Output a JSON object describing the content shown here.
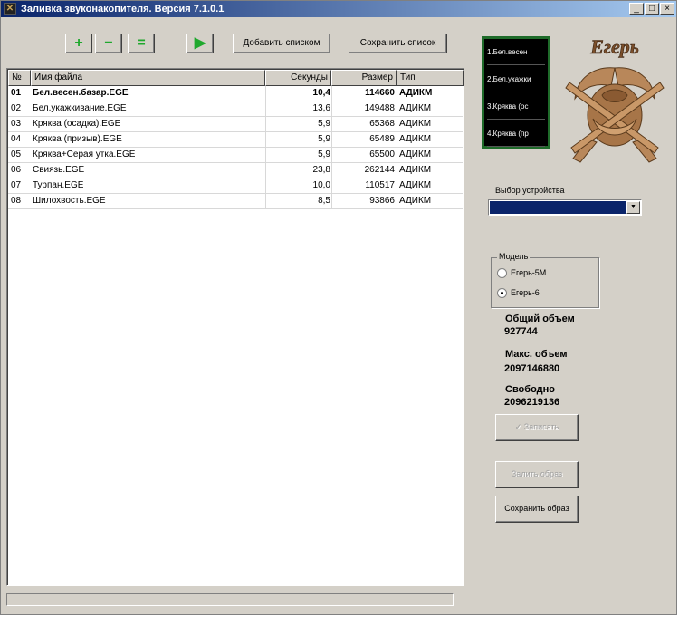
{
  "window": {
    "title": "Заливка звуконакопителя. Версия 7.1.0.1",
    "app_icon": "app-logo-icon",
    "controls": {
      "minimize": "_",
      "maximize": "□",
      "close": "×"
    }
  },
  "toolbar": {
    "add_icon": "+",
    "remove_icon": "−",
    "equal_icon": "=",
    "play_icon": "▶",
    "add_list_label": "Добавить списком",
    "save_list_label": "Сохранить список",
    "accent_color": "#1fa82d"
  },
  "table": {
    "columns": {
      "num": "№",
      "name": "Имя файла",
      "seconds": "Секунды",
      "size": "Размер",
      "type": "Тип"
    },
    "rows": [
      {
        "num": "01",
        "name": "Бел.весен.базар.EGE",
        "seconds": "10,4",
        "size": "114660",
        "type": "АДИКМ"
      },
      {
        "num": "02",
        "name": "Бел.укажкивание.EGE",
        "seconds": "13,6",
        "size": "149488",
        "type": "АДИКМ"
      },
      {
        "num": "03",
        "name": "Кряква (осадка).EGE",
        "seconds": "5,9",
        "size": "65368",
        "type": "АДИКМ"
      },
      {
        "num": "04",
        "name": "Кряква (призыв).EGE",
        "seconds": "5,9",
        "size": "65489",
        "type": "АДИКМ"
      },
      {
        "num": "05",
        "name": "Кряква+Серая утка.EGE",
        "seconds": "5,9",
        "size": "65500",
        "type": "АДИКМ"
      },
      {
        "num": "06",
        "name": "Свиязь.EGE",
        "seconds": "23,8",
        "size": "262144",
        "type": "АДИКМ"
      },
      {
        "num": "07",
        "name": "Турпан.EGE",
        "seconds": "10,0",
        "size": "110517",
        "type": "АДИКМ"
      },
      {
        "num": "08",
        "name": "Шилохвость.EGE",
        "seconds": "8,5",
        "size": "93866",
        "type": "АДИКМ"
      }
    ]
  },
  "slots": [
    "1.Бел.весен",
    "2.Бел.укажки",
    "3.Кряква (ос",
    "4.Кряква (пр"
  ],
  "emblem": {
    "text": "Егерь",
    "icon": "crossed-rifles-emblem-icon"
  },
  "device": {
    "label": "Выбор устройства",
    "selected": ""
  },
  "model": {
    "legend": "Модель",
    "options": [
      {
        "label": "Егерь-5М",
        "checked": false
      },
      {
        "label": "Егерь-6",
        "checked": true
      }
    ]
  },
  "stats": {
    "total_title": "Общий объем",
    "total_value": "927744",
    "max_title": "Макс. объем",
    "max_value": "2097146880",
    "free_title": "Свободно",
    "free_value": "2096219136"
  },
  "buttons": {
    "write_label": "Записать",
    "read_image_label": "Залить образ",
    "save_image_label": "Сохранить образ"
  },
  "colors": {
    "panel_border": "#1f6b2a",
    "selection": "#0a246a",
    "emblem_bronze": "#b8875a"
  }
}
